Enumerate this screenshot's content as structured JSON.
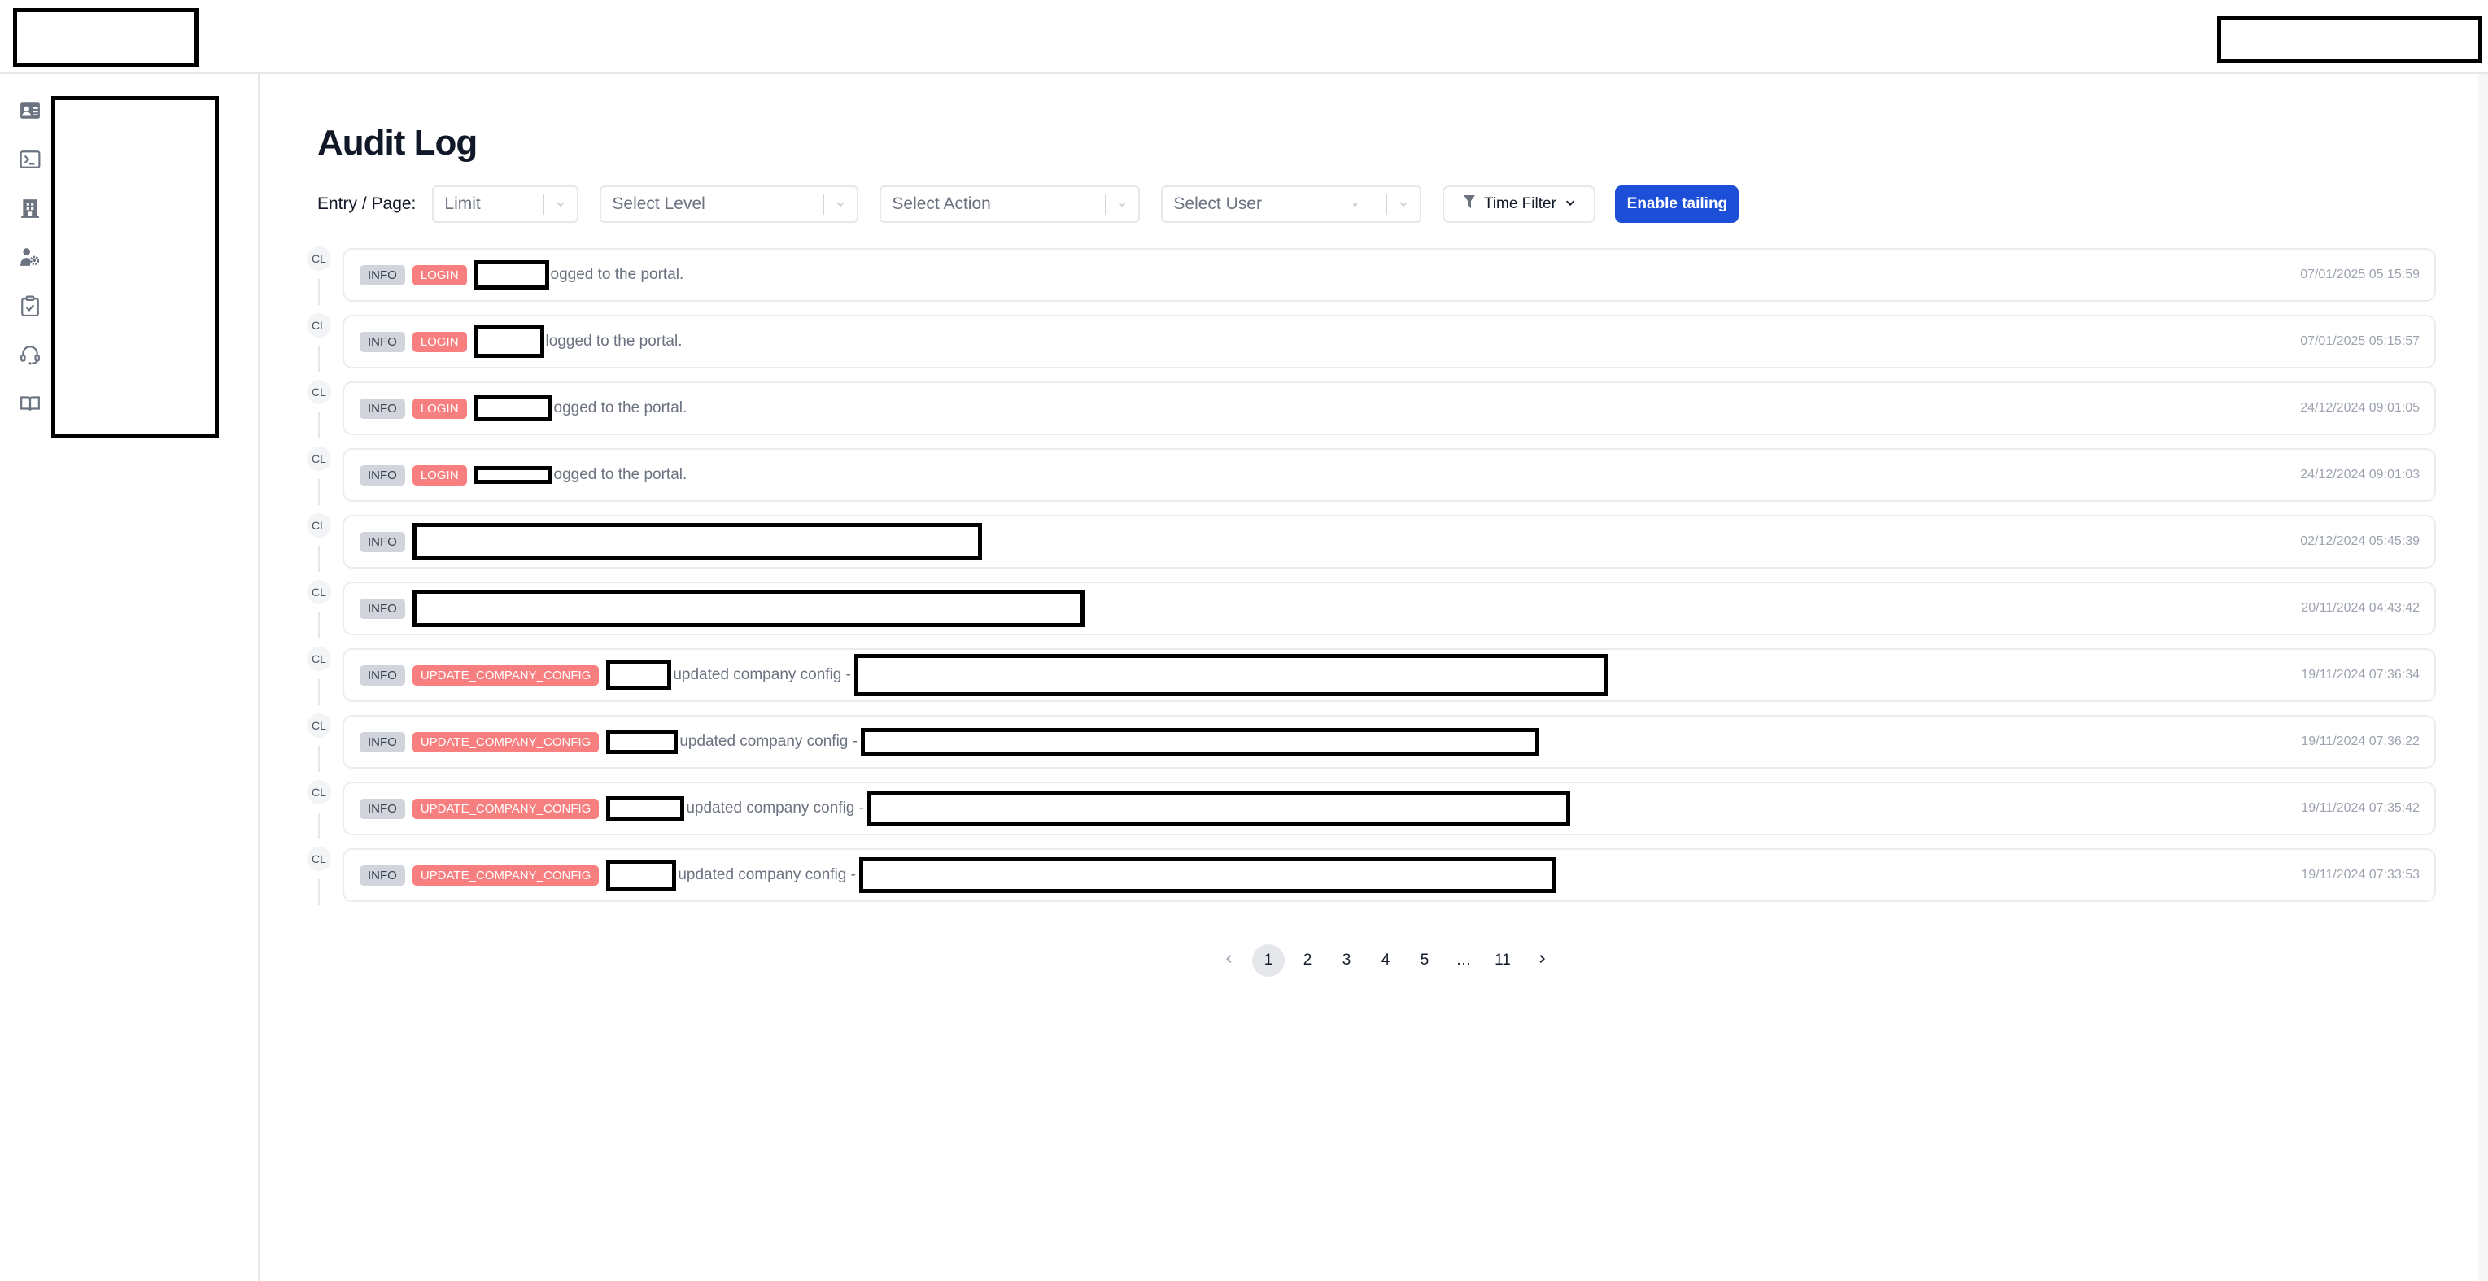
{
  "page": {
    "title": "Audit Log"
  },
  "sidebar": {
    "items": [
      {
        "icon": "contact-card-icon"
      },
      {
        "icon": "terminal-icon"
      },
      {
        "icon": "building-icon"
      },
      {
        "icon": "user-settings-icon"
      },
      {
        "icon": "clipboard-check-icon"
      },
      {
        "icon": "headset-icon"
      },
      {
        "icon": "book-icon"
      }
    ]
  },
  "toolbar": {
    "entry_label": "Entry / Page:",
    "limit_placeholder": "Limit",
    "level_placeholder": "Select Level",
    "action_placeholder": "Select Action",
    "user_placeholder": "Select User",
    "time_filter_label": "Time Filter",
    "tail_button_label": "Enable tailing"
  },
  "logs": [
    {
      "avatar": "CL",
      "level": "INFO",
      "action": "LOGIN",
      "message": "ogged to the portal.",
      "timestamp": "07/01/2025 05:15:59"
    },
    {
      "avatar": "CL",
      "level": "INFO",
      "action": "LOGIN",
      "message": "logged to the portal.",
      "timestamp": "07/01/2025 05:15:57"
    },
    {
      "avatar": "CL",
      "level": "INFO",
      "action": "LOGIN",
      "message": "ogged to the portal.",
      "timestamp": "24/12/2024 09:01:05"
    },
    {
      "avatar": "CL",
      "level": "INFO",
      "action": "LOGIN",
      "message": "ogged to the portal.",
      "timestamp": "24/12/2024 09:01:03"
    },
    {
      "avatar": "CL",
      "level": "INFO",
      "action": "",
      "message": "",
      "timestamp": "02/12/2024 05:45:39"
    },
    {
      "avatar": "CL",
      "level": "INFO",
      "action": "",
      "message": "",
      "timestamp": "20/11/2024 04:43:42"
    },
    {
      "avatar": "CL",
      "level": "INFO",
      "action": "UPDATE_COMPANY_CONFIG",
      "message": "updated company config -",
      "timestamp": "19/11/2024 07:36:34"
    },
    {
      "avatar": "CL",
      "level": "INFO",
      "action": "UPDATE_COMPANY_CONFIG",
      "message": "updated company config -",
      "timestamp": "19/11/2024 07:36:22"
    },
    {
      "avatar": "CL",
      "level": "INFO",
      "action": "UPDATE_COMPANY_CONFIG",
      "message": "updated company config -",
      "timestamp": "19/11/2024 07:35:42"
    },
    {
      "avatar": "CL",
      "level": "INFO",
      "action": "UPDATE_COMPANY_CONFIG",
      "message": "updated company config -",
      "timestamp": "19/11/2024 07:33:53"
    }
  ],
  "pagination": {
    "current": "1",
    "pages": [
      "1",
      "2",
      "3",
      "4",
      "5",
      "…",
      "11"
    ]
  },
  "colors": {
    "accent": "#1d4ed8",
    "action_badge": "#f87f7f",
    "info_badge": "#d1d5db"
  }
}
